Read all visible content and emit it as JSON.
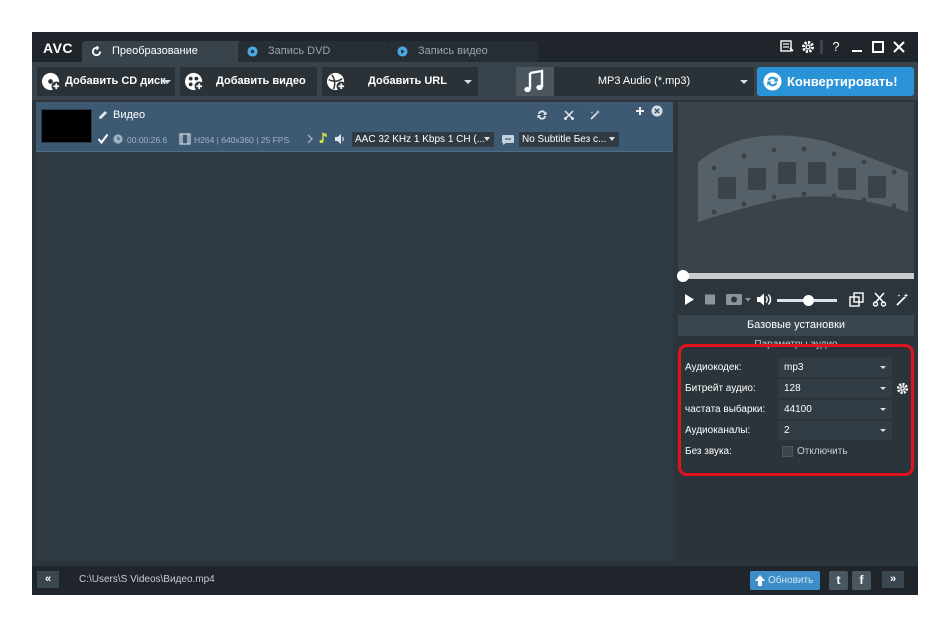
{
  "app": {
    "logo": "AVC"
  },
  "tabs": [
    {
      "label": "Преобразование",
      "active": true
    },
    {
      "label": "Запись DVD",
      "active": false
    },
    {
      "label": "Запись видео",
      "active": false
    }
  ],
  "window_controls": {
    "help": "?"
  },
  "toolbar": {
    "add_cd_label": "Добавить CD диск",
    "add_video_label": "Добавить видео",
    "add_url_label": "Добавить URL",
    "format_label": "MP3 Audio (*.mp3)",
    "convert_label": "Конвертировать!"
  },
  "file": {
    "name": "Видео",
    "checked": true,
    "duration": "00:00:26.6",
    "video_info": "H264 | 640x360 | 25 FPS",
    "audio_track": "AAC 32 KHz 1 Kbps 1 CH (...",
    "subtitle": "No Subtitle Без с..."
  },
  "settings": {
    "header": "Базовые установки",
    "section": "Параметры аудио",
    "rows": [
      {
        "label": "Аудиокодек:",
        "value": "mp3"
      },
      {
        "label": "Битрейт аудио:",
        "value": "128"
      },
      {
        "label": "частата выбарки:",
        "value": "44100"
      },
      {
        "label": "Аудиоканалы:",
        "value": "2"
      }
    ],
    "mute_label": "Без звука:",
    "mute_option": "Отключить"
  },
  "statusbar": {
    "collapse": "«",
    "path": "C:\\Users\\S        Videos\\Видео.mp4",
    "update_label": "Обновить",
    "expand": "»",
    "twitter": "t",
    "facebook": "f"
  },
  "colors": {
    "accent": "#2a92d6",
    "highlight": "#e0131c",
    "selected_row": "#3e5a73"
  }
}
